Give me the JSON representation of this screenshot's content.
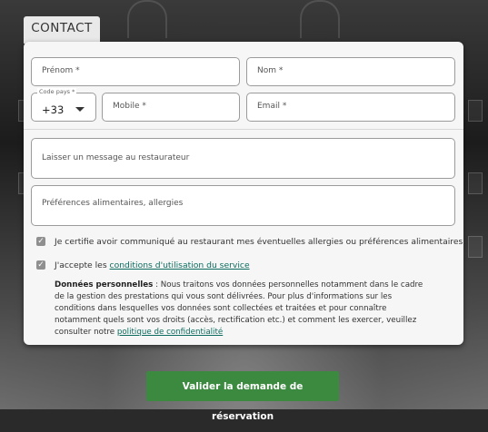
{
  "section_tab": "CONTACT",
  "fields": {
    "prenom": "Prénom *",
    "nom": "Nom *",
    "code_pays_label": "Code pays *",
    "code_pays_value": "+33",
    "mobile": "Mobile *",
    "email": "Email *",
    "message": "Laisser un message au restaurateur",
    "preferences": "Préférences alimentaires, allergies"
  },
  "checkboxes": {
    "allergies": "Je certifie avoir communiqué au restaurant mes éventuelles allergies ou préférences alimentaires",
    "conditions_prefix": "J'accepte les ",
    "conditions_link": "conditions d'utilisation du service"
  },
  "legal": {
    "title": "Données personnelles",
    "body": " : Nous traitons vos données personnelles notamment dans le cadre de la gestion des prestations qui vous sont délivrées. Pour plus d'informations sur les conditions dans lesquelles vos données sont collectées et traitées et pour connaître notamment quels sont vos droits (accès, rectification etc.) et comment les exercer, veuillez consulter notre ",
    "link": "politique de confidentialité"
  },
  "submit_label": "Valider la demande de réservation",
  "colors": {
    "accent": "#3b8a3f",
    "link": "#0c6b5e"
  }
}
